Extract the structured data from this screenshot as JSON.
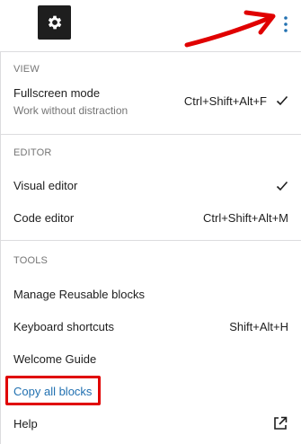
{
  "toolbar": {
    "settings_icon": "gear-icon",
    "options_icon": "kebab-vertical-icon"
  },
  "menu": {
    "view": {
      "label": "VIEW",
      "items": [
        {
          "label": "Fullscreen mode",
          "description": "Work without distraction",
          "shortcut": "Ctrl+Shift+Alt+F",
          "checked": true
        }
      ]
    },
    "editor": {
      "label": "EDITOR",
      "items": [
        {
          "label": "Visual editor",
          "shortcut": "",
          "checked": true
        },
        {
          "label": "Code editor",
          "shortcut": "Ctrl+Shift+Alt+M",
          "checked": false
        }
      ]
    },
    "tools": {
      "label": "TOOLS",
      "items": [
        {
          "label": "Manage Reusable blocks",
          "shortcut": ""
        },
        {
          "label": "Keyboard shortcuts",
          "shortcut": "Shift+Alt+H"
        },
        {
          "label": "Welcome Guide",
          "shortcut": ""
        },
        {
          "label": "Copy all blocks",
          "shortcut": "",
          "highlighted": true
        },
        {
          "label": "Help",
          "shortcut": "",
          "icon": "external-link-icon"
        }
      ]
    }
  },
  "colors": {
    "accent_link": "#2271b1",
    "annotation_red": "#e00000",
    "dark_button": "#1e1e1e"
  }
}
